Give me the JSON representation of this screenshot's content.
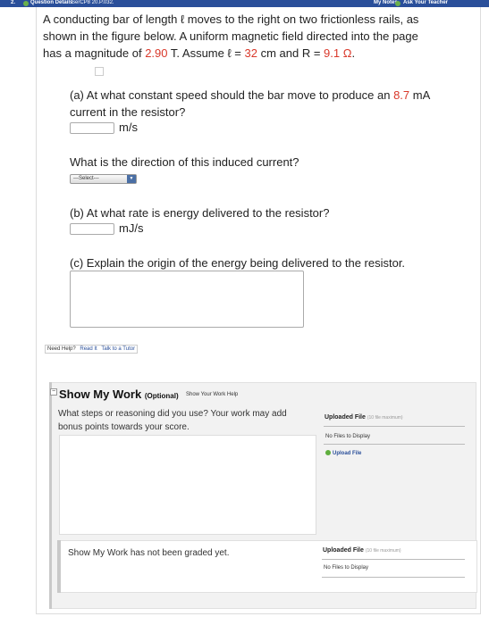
{
  "topbar": {
    "number": "2.",
    "details": "Question Details",
    "code": "SerCP8 20.P.032.",
    "my_notes": "My Notes",
    "ask_teacher": "Ask Your Teacher"
  },
  "question": {
    "line1": "A conducting bar of length ℓ moves to the right on two frictionless rails, as",
    "line2": "shown in the figure below. A uniform magnetic field directed into the page",
    "line3_pre": "has a magnitude of ",
    "field_value": "2.90",
    "line3_mid": " T. Assume ℓ = ",
    "length_value": "32",
    "line3_mid2": " cm and R = ",
    "resistance_value": "9.1 Ω",
    "line3_end": "."
  },
  "part_a": {
    "text_pre": "(a) At what constant speed should the bar move to produce an ",
    "current_value": "8.7",
    "text_unit": " mA",
    "line2": "current in the resistor?",
    "answer_value": "",
    "unit": "m/s"
  },
  "direction": {
    "question": "What is the direction of this induced current?",
    "selected": "---Select---",
    "arrow": "▼"
  },
  "part_b": {
    "text": "(b) At what rate is energy delivered to the resistor?",
    "answer_value": "",
    "unit": "mJ/s"
  },
  "part_c": {
    "text": "(c) Explain the origin of the energy being delivered to the resistor.",
    "answer_value": ""
  },
  "help": {
    "label": "Need Help?",
    "read_it": "Read It",
    "tutor": "Talk to a Tutor"
  },
  "show_my_work": {
    "collapse": "−",
    "title": "Show My Work",
    "optional": "(Optional)",
    "help_link": "Show Your Work Help",
    "question_line1": "What steps or reasoning did you use? Your work may add",
    "question_line2": "bonus points towards your score.",
    "work_value": "",
    "uploaded_label": "Uploaded File",
    "uploaded_max": "(10 file maximum)",
    "no_files": "No Files to Display",
    "upload_button": "Upload File",
    "graded_text": "Show My Work has not been graded yet.",
    "uploaded_label_2": "Uploaded File",
    "uploaded_max_2": "(10 file maximum)",
    "no_files_2": "No Files to Display"
  }
}
